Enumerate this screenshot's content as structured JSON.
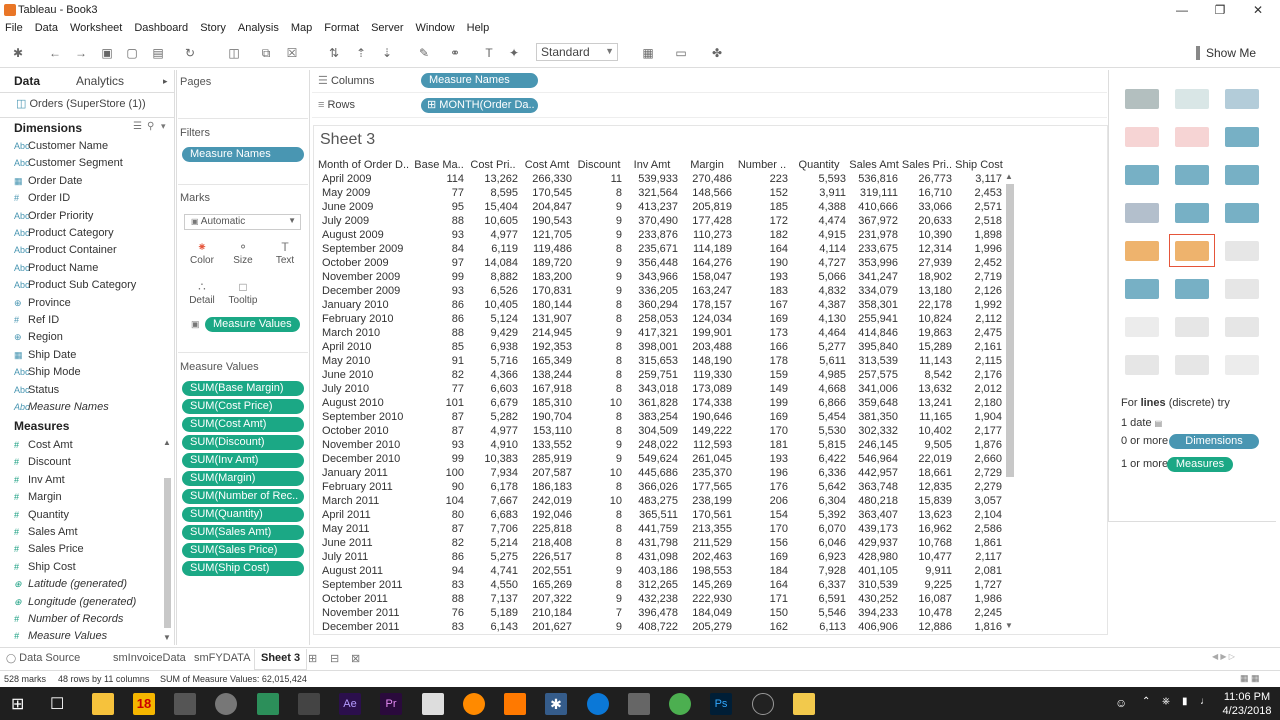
{
  "window": {
    "title": "Tableau - Book3",
    "icon": "tableau-logo-icon"
  },
  "menu": [
    "File",
    "Data",
    "Worksheet",
    "Dashboard",
    "Story",
    "Analysis",
    "Map",
    "Format",
    "Server",
    "Window",
    "Help"
  ],
  "toolbar": {
    "fit_value": "Standard",
    "show_me_label": "Show Me"
  },
  "data_pane": {
    "tab_data": "Data",
    "tab_analytics": "Analytics",
    "datasource": "Orders (SuperStore (1))",
    "dimensions_header": "Dimensions",
    "dimensions": [
      {
        "name": "Customer Name",
        "icon": "Abc"
      },
      {
        "name": "Customer Segment",
        "icon": "Abc"
      },
      {
        "name": "Order Date",
        "icon": "calendar-icon"
      },
      {
        "name": "Order ID",
        "icon": "#"
      },
      {
        "name": "Order Priority",
        "icon": "Abc"
      },
      {
        "name": "Product Category",
        "icon": "Abc"
      },
      {
        "name": "Product Container",
        "icon": "Abc"
      },
      {
        "name": "Product Name",
        "icon": "Abc"
      },
      {
        "name": "Product Sub Category",
        "icon": "Abc"
      },
      {
        "name": "Province",
        "icon": "globe-icon"
      },
      {
        "name": "Ref ID",
        "icon": "#"
      },
      {
        "name": "Region",
        "icon": "globe-icon"
      },
      {
        "name": "Ship Date",
        "icon": "calendar-icon"
      },
      {
        "name": "Ship Mode",
        "icon": "Abc"
      },
      {
        "name": "Status",
        "icon": "Abc"
      },
      {
        "name": "Measure Names",
        "icon": "Abc"
      }
    ],
    "measures_header": "Measures",
    "measures": [
      {
        "name": "Cost Amt",
        "icon": "#"
      },
      {
        "name": "Discount",
        "icon": "#"
      },
      {
        "name": "Inv Amt",
        "icon": "#"
      },
      {
        "name": "Margin",
        "icon": "#"
      },
      {
        "name": "Quantity",
        "icon": "#"
      },
      {
        "name": "Sales Amt",
        "icon": "#"
      },
      {
        "name": "Sales Price",
        "icon": "#"
      },
      {
        "name": "Ship Cost",
        "icon": "#"
      },
      {
        "name": "Latitude (generated)",
        "icon": "globe-icon"
      },
      {
        "name": "Longitude (generated)",
        "icon": "globe-icon"
      },
      {
        "name": "Number of Records",
        "icon": "#"
      },
      {
        "name": "Measure Values",
        "icon": "#"
      }
    ]
  },
  "pages_label": "Pages",
  "filters_label": "Filters",
  "filter_pill": "Measure Names",
  "marks": {
    "label": "Marks",
    "type": "Automatic",
    "buttons": [
      "Color",
      "Size",
      "Text",
      "Detail",
      "Tooltip"
    ],
    "text_pill": "Measure Values"
  },
  "measure_values": {
    "label": "Measure Values",
    "pills": [
      "SUM(Base Margin)",
      "SUM(Cost Price)",
      "SUM(Cost Amt)",
      "SUM(Discount)",
      "SUM(Inv Amt)",
      "SUM(Margin)",
      "SUM(Number of Rec..",
      "SUM(Quantity)",
      "SUM(Sales Amt)",
      "SUM(Sales Price)",
      "SUM(Ship Cost)"
    ]
  },
  "columns": {
    "label": "Columns",
    "pill": "Measure Names"
  },
  "rows": {
    "label": "Rows",
    "pill": "MONTH(Order Da.."
  },
  "sheet_title": "Sheet 3",
  "table": {
    "headers": [
      "Month of Order D..",
      "Base Ma..",
      "Cost Pri..",
      "Cost Amt",
      "Discount",
      "Inv Amt",
      "Margin",
      "Number ..",
      "Quantity",
      "Sales Amt",
      "Sales Pri..",
      "Ship Cost"
    ],
    "rows": [
      [
        "April 2009",
        "114",
        "13,262",
        "266,330",
        "11",
        "539,933",
        "270,486",
        "223",
        "5,593",
        "536,816",
        "26,773",
        "3,117"
      ],
      [
        "May 2009",
        "77",
        "8,595",
        "170,545",
        "8",
        "321,564",
        "148,566",
        "152",
        "3,911",
        "319,111",
        "16,710",
        "2,453"
      ],
      [
        "June 2009",
        "95",
        "15,404",
        "204,847",
        "9",
        "413,237",
        "205,819",
        "185",
        "4,388",
        "410,666",
        "33,066",
        "2,571"
      ],
      [
        "July 2009",
        "88",
        "10,605",
        "190,543",
        "9",
        "370,490",
        "177,428",
        "172",
        "4,474",
        "367,972",
        "20,633",
        "2,518"
      ],
      [
        "August 2009",
        "93",
        "4,977",
        "121,705",
        "9",
        "233,876",
        "110,273",
        "182",
        "4,915",
        "231,978",
        "10,390",
        "1,898"
      ],
      [
        "September 2009",
        "84",
        "6,119",
        "119,486",
        "8",
        "235,671",
        "114,189",
        "164",
        "4,114",
        "233,675",
        "12,314",
        "1,996"
      ],
      [
        "October 2009",
        "97",
        "14,084",
        "189,720",
        "9",
        "356,448",
        "164,276",
        "190",
        "4,727",
        "353,996",
        "27,939",
        "2,452"
      ],
      [
        "November 2009",
        "99",
        "8,882",
        "183,200",
        "9",
        "343,966",
        "158,047",
        "193",
        "5,066",
        "341,247",
        "18,902",
        "2,719"
      ],
      [
        "December 2009",
        "93",
        "6,526",
        "170,831",
        "9",
        "336,205",
        "163,247",
        "183",
        "4,832",
        "334,079",
        "13,180",
        "2,126"
      ],
      [
        "January 2010",
        "86",
        "10,405",
        "180,144",
        "8",
        "360,294",
        "178,157",
        "167",
        "4,387",
        "358,301",
        "22,178",
        "1,992"
      ],
      [
        "February 2010",
        "86",
        "5,124",
        "131,907",
        "8",
        "258,053",
        "124,034",
        "169",
        "4,130",
        "255,941",
        "10,824",
        "2,112"
      ],
      [
        "March 2010",
        "88",
        "9,429",
        "214,945",
        "9",
        "417,321",
        "199,901",
        "173",
        "4,464",
        "414,846",
        "19,863",
        "2,475"
      ],
      [
        "April 2010",
        "85",
        "6,938",
        "192,353",
        "8",
        "398,001",
        "203,488",
        "166",
        "5,277",
        "395,840",
        "15,289",
        "2,161"
      ],
      [
        "May 2010",
        "91",
        "5,716",
        "165,349",
        "8",
        "315,653",
        "148,190",
        "178",
        "5,611",
        "313,539",
        "11,143",
        "2,115"
      ],
      [
        "June 2010",
        "82",
        "4,366",
        "138,244",
        "8",
        "259,751",
        "119,330",
        "159",
        "4,985",
        "257,575",
        "8,542",
        "2,176"
      ],
      [
        "July 2010",
        "77",
        "6,603",
        "167,918",
        "8",
        "343,018",
        "173,089",
        "149",
        "4,668",
        "341,006",
        "13,632",
        "2,012"
      ],
      [
        "August 2010",
        "101",
        "6,679",
        "185,310",
        "10",
        "361,828",
        "174,338",
        "199",
        "6,866",
        "359,648",
        "13,241",
        "2,180"
      ],
      [
        "September 2010",
        "87",
        "5,282",
        "190,704",
        "8",
        "383,254",
        "190,646",
        "169",
        "5,454",
        "381,350",
        "11,165",
        "1,904"
      ],
      [
        "October 2010",
        "87",
        "4,977",
        "153,110",
        "8",
        "304,509",
        "149,222",
        "170",
        "5,530",
        "302,332",
        "10,402",
        "2,177"
      ],
      [
        "November 2010",
        "93",
        "4,910",
        "133,552",
        "9",
        "248,022",
        "112,593",
        "181",
        "5,815",
        "246,145",
        "9,505",
        "1,876"
      ],
      [
        "December 2010",
        "99",
        "10,383",
        "285,919",
        "9",
        "549,624",
        "261,045",
        "193",
        "6,422",
        "546,964",
        "22,019",
        "2,660"
      ],
      [
        "January 2011",
        "100",
        "7,934",
        "207,587",
        "10",
        "445,686",
        "235,370",
        "196",
        "6,336",
        "442,957",
        "18,661",
        "2,729"
      ],
      [
        "February 2011",
        "90",
        "6,178",
        "186,183",
        "8",
        "366,026",
        "177,565",
        "176",
        "5,642",
        "363,748",
        "12,835",
        "2,279"
      ],
      [
        "March 2011",
        "104",
        "7,667",
        "242,019",
        "10",
        "483,275",
        "238,199",
        "206",
        "6,304",
        "480,218",
        "15,839",
        "3,057"
      ],
      [
        "April 2011",
        "80",
        "6,683",
        "192,046",
        "8",
        "365,511",
        "170,561",
        "154",
        "5,392",
        "363,407",
        "13,623",
        "2,104"
      ],
      [
        "May 2011",
        "87",
        "7,706",
        "225,818",
        "8",
        "441,759",
        "213,355",
        "170",
        "6,070",
        "439,173",
        "16,962",
        "2,586"
      ],
      [
        "June 2011",
        "82",
        "5,214",
        "218,408",
        "8",
        "431,798",
        "211,529",
        "156",
        "6,046",
        "429,937",
        "10,768",
        "1,861"
      ],
      [
        "July 2011",
        "86",
        "5,275",
        "226,517",
        "8",
        "431,098",
        "202,463",
        "169",
        "6,923",
        "428,980",
        "10,477",
        "2,117"
      ],
      [
        "August 2011",
        "94",
        "4,741",
        "202,551",
        "9",
        "403,186",
        "198,553",
        "184",
        "7,928",
        "401,105",
        "9,911",
        "2,081"
      ],
      [
        "September 2011",
        "83",
        "4,550",
        "165,269",
        "8",
        "312,265",
        "145,269",
        "164",
        "6,337",
        "310,539",
        "9,225",
        "1,727"
      ],
      [
        "October 2011",
        "88",
        "7,137",
        "207,322",
        "9",
        "432,238",
        "222,930",
        "171",
        "6,591",
        "430,252",
        "16,087",
        "1,986"
      ],
      [
        "November 2011",
        "76",
        "5,189",
        "210,184",
        "7",
        "396,478",
        "184,049",
        "150",
        "5,546",
        "394,233",
        "10,478",
        "2,245"
      ],
      [
        "December 2011",
        "83",
        "6,143",
        "201,627",
        "9",
        "408,722",
        "205,279",
        "162",
        "6,113",
        "406,906",
        "12,886",
        "1,816"
      ]
    ]
  },
  "show_me": {
    "hint_prefix": "For",
    "hint_bold": "lines",
    "hint_suffix": "(discrete) try",
    "req1": "1 date",
    "req2_prefix": "0 or more",
    "req2_pill": "Dimensions",
    "req3_prefix": "1 or more",
    "req3_pill": "Measures"
  },
  "tabs": {
    "datasource": "Data Source",
    "sheets": [
      "smInvoiceData",
      "smFYDATA",
      "Sheet 3"
    ]
  },
  "status": {
    "marks": "528 marks",
    "dims": "48 rows by 11 columns",
    "sum": "SUM of Measure Values: 62,015,424"
  },
  "clock": {
    "time": "11:06 PM",
    "date": "4/23/2018"
  },
  "colors": {
    "measure_pill": "#1ba885",
    "dimension_pill": "#4996b2",
    "selected_chart": "#e5553a"
  }
}
